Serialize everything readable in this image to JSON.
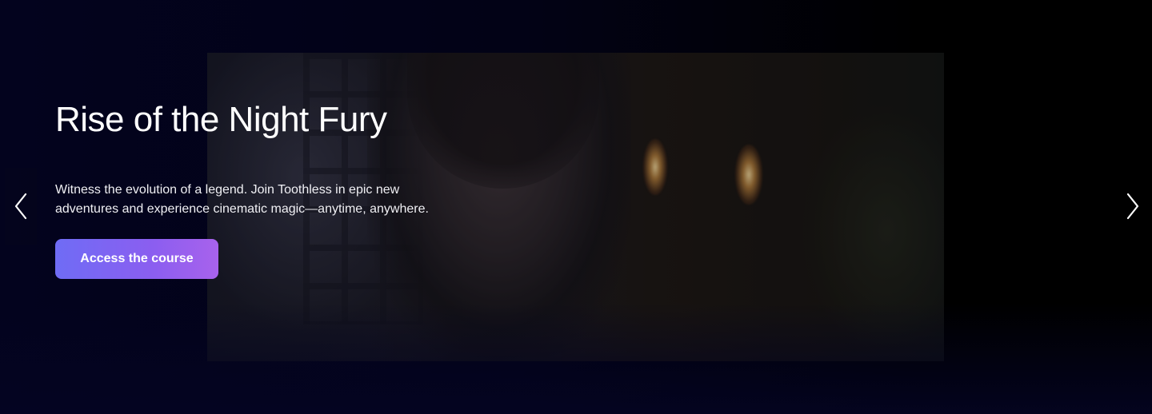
{
  "hero": {
    "title": "Rise of the Night Fury",
    "description": "Witness the evolution of a legend. Join Toothless in epic new adventures and experience cinematic magic—anytime, anywhere.",
    "cta_label": "Access the course"
  },
  "navigation": {
    "prev_icon": "chevron-left-icon",
    "next_icon": "chevron-right-icon"
  },
  "colors": {
    "background": "#02021a",
    "cta_gradient_start": "#6f6cf5",
    "cta_gradient_end": "#a862ec",
    "text": "#ffffff"
  }
}
